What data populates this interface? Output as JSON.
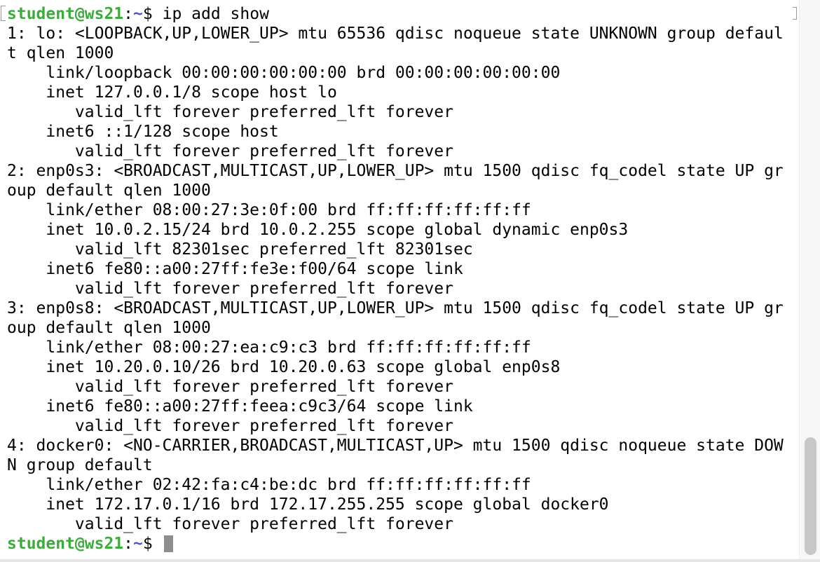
{
  "terminal": {
    "prompt": {
      "user_host": "student@ws21",
      "path": "~",
      "symbol": "$"
    },
    "command": "ip add show",
    "output_lines": [
      "1: lo: <LOOPBACK,UP,LOWER_UP> mtu 65536 qdisc noqueue state UNKNOWN group defaul",
      "t qlen 1000",
      "    link/loopback 00:00:00:00:00:00 brd 00:00:00:00:00:00",
      "    inet 127.0.0.1/8 scope host lo",
      "       valid_lft forever preferred_lft forever",
      "    inet6 ::1/128 scope host",
      "       valid_lft forever preferred_lft forever",
      "2: enp0s3: <BROADCAST,MULTICAST,UP,LOWER_UP> mtu 1500 qdisc fq_codel state UP gr",
      "oup default qlen 1000",
      "    link/ether 08:00:27:3e:0f:00 brd ff:ff:ff:ff:ff:ff",
      "    inet 10.0.2.15/24 brd 10.0.2.255 scope global dynamic enp0s3",
      "       valid_lft 82301sec preferred_lft 82301sec",
      "    inet6 fe80::a00:27ff:fe3e:f00/64 scope link",
      "       valid_lft forever preferred_lft forever",
      "3: enp0s8: <BROADCAST,MULTICAST,UP,LOWER_UP> mtu 1500 qdisc fq_codel state UP gr",
      "oup default qlen 1000",
      "    link/ether 08:00:27:ea:c9:c3 brd ff:ff:ff:ff:ff:ff",
      "    inet 10.20.0.10/26 brd 10.20.0.63 scope global enp0s8",
      "       valid_lft forever preferred_lft forever",
      "    inet6 fe80::a00:27ff:feea:c9c3/64 scope link",
      "       valid_lft forever preferred_lft forever",
      "4: docker0: <NO-CARRIER,BROADCAST,MULTICAST,UP> mtu 1500 qdisc noqueue state DOW",
      "N group default",
      "    link/ether 02:42:fa:c4:be:dc brd ff:ff:ff:ff:ff:ff",
      "    inet 172.17.0.1/16 brd 172.17.255.255 scope global docker0",
      "       valid_lft forever preferred_lft forever"
    ]
  },
  "colors": {
    "prompt_user": "#3cab3c",
    "prompt_path": "#4a56c8",
    "text": "#000000",
    "background": "#ffffff"
  }
}
